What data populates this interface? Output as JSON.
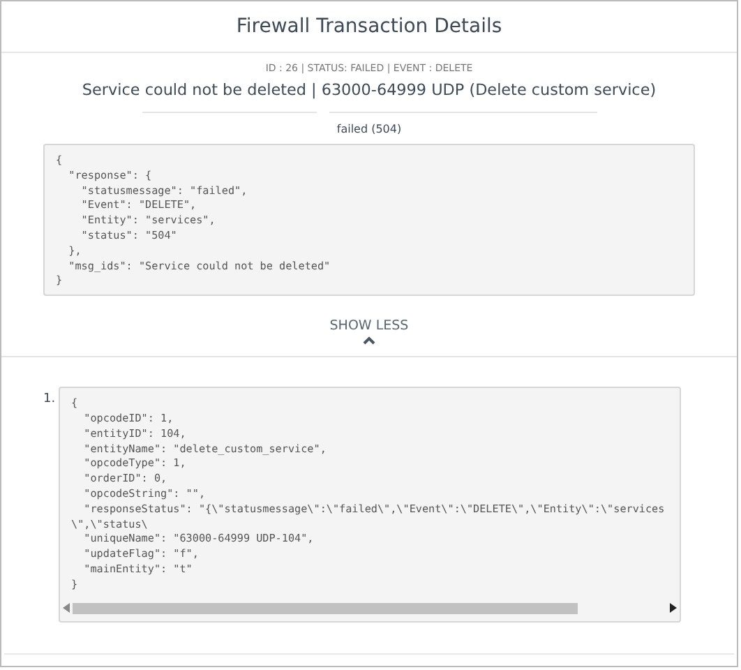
{
  "dialog": {
    "title": "Firewall Transaction Details"
  },
  "summary": {
    "meta": "ID : 26 | STATUS: FAILED | EVENT : DELETE",
    "headline": "Service could not be deleted | 63000-64999 UDP (Delete custom service)",
    "result": "failed (504)"
  },
  "response_code": [
    "{",
    "  \"response\": {",
    "    \"statusmessage\": \"failed\",",
    "    \"Event\": \"DELETE\",",
    "    \"Entity\": \"services\",",
    "    \"status\": \"504\"",
    "  },",
    "  \"msg_ids\": \"Service could not be deleted\"",
    "}"
  ],
  "toggle": {
    "label": "SHOW LESS",
    "expanded": true
  },
  "operations": [
    {
      "number": "1.",
      "code": [
        "{",
        "  \"opcodeID\": 1,",
        "  \"entityID\": 104,",
        "  \"entityName\": \"delete_custom_service\",",
        "  \"opcodeType\": 1,",
        "  \"orderID\": 0,",
        "  \"opcodeString\": \"\",",
        "  \"responseStatus\": \"{\\\"statusmessage\\\":\\\"failed\\\",\\\"Event\\\":\\\"DELETE\\\",\\\"Entity\\\":\\\"services\\\",\\\"status\\",
        "  \"uniqueName\": \"63000-64999 UDP-104\",",
        "  \"updateFlag\": \"f\",",
        "  \"mainEntity\": \"t\"",
        "}"
      ]
    }
  ]
}
